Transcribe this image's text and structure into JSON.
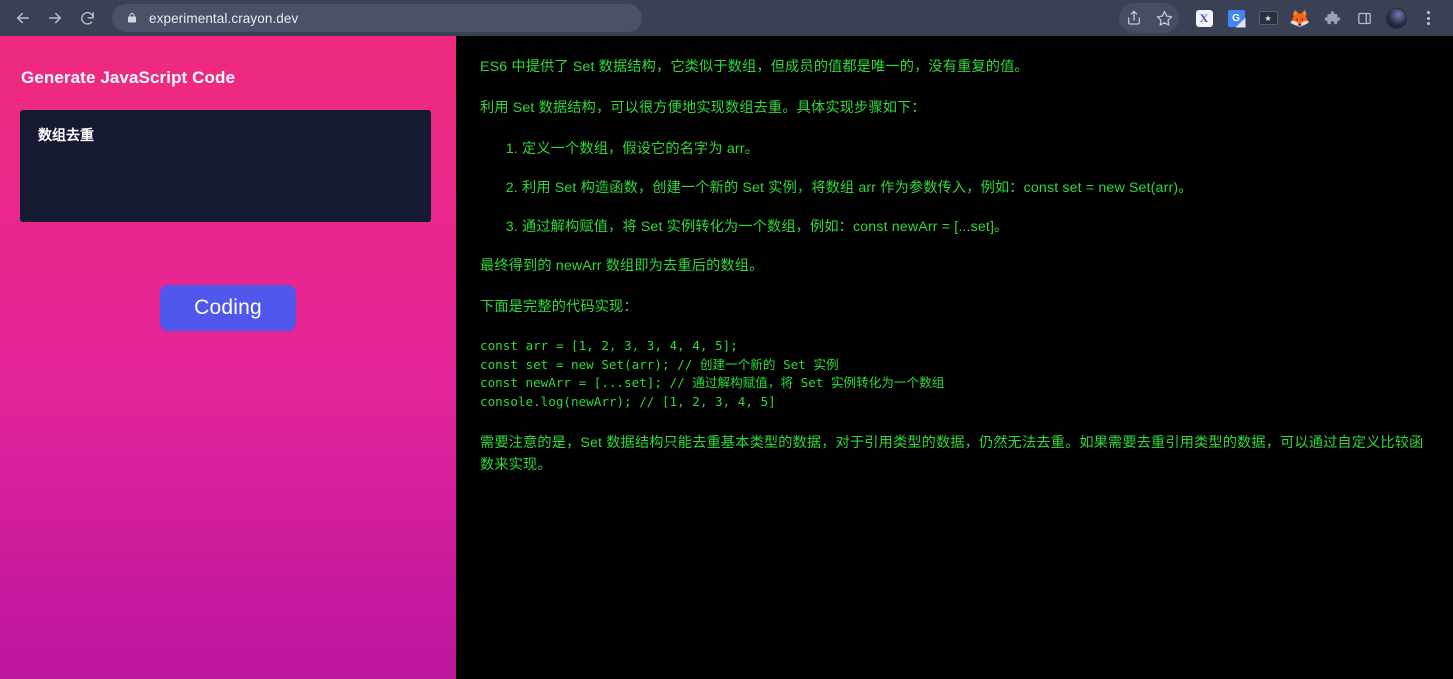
{
  "browser": {
    "back_label": "Back",
    "forward_label": "Forward",
    "reload_label": "Reload",
    "url": "experimental.crayon.dev",
    "lock_icon": "lock-icon",
    "share_icon": "share-icon",
    "bookmark_icon": "star-icon",
    "extensions": [
      {
        "name": "x-extension-icon",
        "glyph": "X"
      },
      {
        "name": "google-translate-icon",
        "glyph": "G"
      },
      {
        "name": "card-extension-icon",
        "glyph": "★"
      },
      {
        "name": "firefox-extension-icon",
        "glyph": "🦊"
      },
      {
        "name": "puzzle-extensions-icon",
        "glyph": "🧩"
      },
      {
        "name": "sidebar-toggle-icon",
        "glyph": "▣"
      }
    ],
    "profile_icon": "profile-avatar-icon",
    "menu_icon": "three-dot-menu-icon"
  },
  "left": {
    "title": "Generate JavaScript Code",
    "prompt_value": "数组去重",
    "prompt_placeholder": "",
    "button_label": "Coding"
  },
  "output": {
    "intro": "ES6 中提供了 Set 数据结构，它类似于数组，但成员的值都是唯一的，没有重复的值。",
    "lead": "利用 Set 数据结构，可以很方便地实现数组去重。具体实现步骤如下：",
    "steps": [
      "定义一个数组，假设它的名字为 arr。",
      "利用 Set 构造函数，创建一个新的 Set 实例，将数组 arr 作为参数传入，例如：const set = new Set(arr)。",
      "通过解构赋值，将 Set 实例转化为一个数组，例如：const newArr = [...set]。"
    ],
    "result_note": "最终得到的 newArr 数组即为去重后的数组。",
    "code_lead": "下面是完整的代码实现：",
    "code": "const arr = [1, 2, 3, 3, 4, 4, 5];\nconst set = new Set(arr); // 创建一个新的 Set 实例\nconst newArr = [...set]; // 通过解构赋值，将 Set 实例转化为一个数组\nconsole.log(newArr); // [1, 2, 3, 4, 5]",
    "caveat": "需要注意的是，Set 数据结构只能去重基本类型的数据，对于引用类型的数据，仍然无法去重。如果需要去重引用类型的数据，可以通过自定义比较函数来实现。"
  },
  "colors": {
    "terminal_green": "#2fd93a",
    "panel_gradient_top": "#ef2a7e",
    "panel_gradient_bottom": "#bb159e",
    "button_blue": "#4f57ec",
    "textarea_navy": "#131a32",
    "chrome_bg": "#3b4155"
  }
}
